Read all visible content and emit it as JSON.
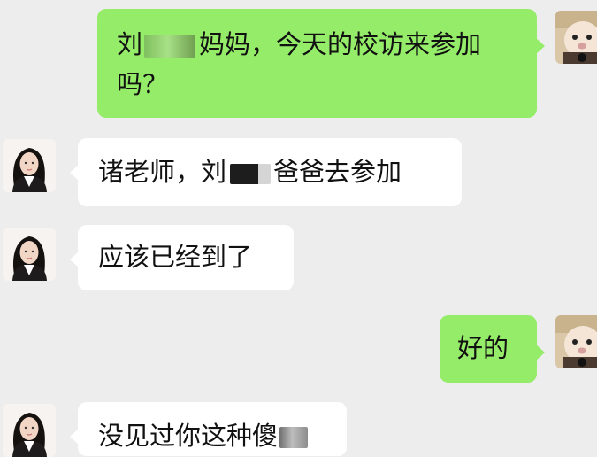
{
  "messages": [
    {
      "sender": "self",
      "parts": [
        "刘",
        "[redacted]",
        "妈妈，今天的校访来参加",
        "吗？"
      ]
    },
    {
      "sender": "teacher",
      "parts": [
        "诸老师，刘",
        "[redacted]",
        "爸爸去参加"
      ]
    },
    {
      "sender": "teacher",
      "parts": [
        "应该已经到了"
      ]
    },
    {
      "sender": "self",
      "parts": [
        "好的"
      ]
    },
    {
      "sender": "teacher",
      "parts": [
        "没见过你这种傻",
        "[redacted]"
      ]
    }
  ],
  "colors": {
    "background": "#EDEDED",
    "sent_bubble": "#95EC69",
    "received_bubble": "#FFFFFF"
  },
  "icons": {
    "self_avatar": "pet-avatar-icon",
    "teacher_avatar": "woman-avatar-icon"
  }
}
